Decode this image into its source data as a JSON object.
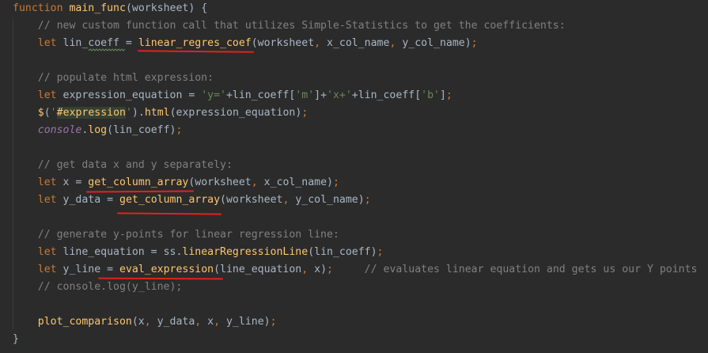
{
  "editor": {
    "lines": [
      {
        "tokens": [
          {
            "t": "function ",
            "c": "kw"
          },
          {
            "t": "main_func",
            "c": "fn"
          },
          {
            "t": "(worksheet) {",
            "c": "pl"
          }
        ]
      },
      {
        "tokens": [
          {
            "t": "    // new custom function call that utilizes Simple-Statistics to get the coefficients:",
            "c": "cm"
          }
        ]
      },
      {
        "tokens": [
          {
            "t": "    ",
            "c": "pl"
          },
          {
            "t": "let ",
            "c": "kw"
          },
          {
            "t": "lin_coeff = ",
            "c": "pl"
          },
          {
            "t": "linear_regres_coef",
            "c": "fn"
          },
          {
            "t": "(worksheet",
            "c": "pl"
          },
          {
            "t": ", ",
            "c": "kw"
          },
          {
            "t": "x_col_name",
            "c": "pl"
          },
          {
            "t": ", ",
            "c": "kw"
          },
          {
            "t": "y_col_name)",
            "c": "pl"
          },
          {
            "t": ";",
            "c": "kw"
          }
        ]
      },
      {
        "tokens": []
      },
      {
        "tokens": [
          {
            "t": "    // populate html expression:",
            "c": "cm"
          }
        ]
      },
      {
        "tokens": [
          {
            "t": "    ",
            "c": "pl"
          },
          {
            "t": "let ",
            "c": "kw"
          },
          {
            "t": "expression_equation = ",
            "c": "pl"
          },
          {
            "t": "'y='",
            "c": "str"
          },
          {
            "t": "+lin_coeff[",
            "c": "pl"
          },
          {
            "t": "'m'",
            "c": "str"
          },
          {
            "t": "]+",
            "c": "pl"
          },
          {
            "t": "'x+'",
            "c": "str"
          },
          {
            "t": "+lin_coeff[",
            "c": "pl"
          },
          {
            "t": "'b'",
            "c": "str"
          },
          {
            "t": "]",
            "c": "pl"
          },
          {
            "t": ";",
            "c": "kw"
          }
        ]
      },
      {
        "tokens": [
          {
            "t": "    ",
            "c": "pl"
          },
          {
            "t": "$",
            "c": "fn"
          },
          {
            "t": "(",
            "c": "pl"
          },
          {
            "t": "'",
            "c": "str"
          },
          {
            "t": "#expression",
            "c": "sel"
          },
          {
            "t": "'",
            "c": "str"
          },
          {
            "t": ").",
            "c": "pl"
          },
          {
            "t": "html",
            "c": "fn"
          },
          {
            "t": "(expression_equation)",
            "c": "pl"
          },
          {
            "t": ";",
            "c": "kw"
          }
        ]
      },
      {
        "tokens": [
          {
            "t": "    ",
            "c": "pl"
          },
          {
            "t": "console",
            "c": "it"
          },
          {
            "t": ".",
            "c": "pl"
          },
          {
            "t": "log",
            "c": "fn"
          },
          {
            "t": "(lin_coeff)",
            "c": "pl"
          },
          {
            "t": ";",
            "c": "kw"
          }
        ]
      },
      {
        "tokens": []
      },
      {
        "tokens": [
          {
            "t": "    // get data x and y separately:",
            "c": "cm"
          }
        ]
      },
      {
        "tokens": [
          {
            "t": "    ",
            "c": "pl"
          },
          {
            "t": "let ",
            "c": "kw"
          },
          {
            "t": "x = ",
            "c": "pl"
          },
          {
            "t": "get_column_array",
            "c": "fn"
          },
          {
            "t": "(worksheet",
            "c": "pl"
          },
          {
            "t": ", ",
            "c": "kw"
          },
          {
            "t": "x_col_name)",
            "c": "pl"
          },
          {
            "t": ";",
            "c": "kw"
          }
        ]
      },
      {
        "tokens": [
          {
            "t": "    ",
            "c": "pl"
          },
          {
            "t": "let ",
            "c": "kw"
          },
          {
            "t": "y_data = ",
            "c": "pl"
          },
          {
            "t": "get_column_array",
            "c": "fn"
          },
          {
            "t": "(worksheet",
            "c": "pl"
          },
          {
            "t": ", ",
            "c": "kw"
          },
          {
            "t": "y_col_name)",
            "c": "pl"
          },
          {
            "t": ";",
            "c": "kw"
          }
        ]
      },
      {
        "tokens": []
      },
      {
        "tokens": [
          {
            "t": "    // generate y-points for linear regression line:",
            "c": "cm"
          }
        ]
      },
      {
        "tokens": [
          {
            "t": "    ",
            "c": "pl"
          },
          {
            "t": "let ",
            "c": "kw"
          },
          {
            "t": "line_equation = ss.",
            "c": "pl"
          },
          {
            "t": "linearRegressionLine",
            "c": "fn"
          },
          {
            "t": "(lin_coeff)",
            "c": "pl"
          },
          {
            "t": ";",
            "c": "kw"
          }
        ]
      },
      {
        "tokens": [
          {
            "t": "    ",
            "c": "pl"
          },
          {
            "t": "let ",
            "c": "kw"
          },
          {
            "t": "y_line = ",
            "c": "pl"
          },
          {
            "t": "eval_expression",
            "c": "fn"
          },
          {
            "t": "(line_equation",
            "c": "pl"
          },
          {
            "t": ", ",
            "c": "kw"
          },
          {
            "t": "x)",
            "c": "pl"
          },
          {
            "t": ";",
            "c": "kw"
          },
          {
            "t": "     // evaluates linear equation and gets us our Y points",
            "c": "cm"
          }
        ]
      },
      {
        "tokens": [
          {
            "t": "    // console.log(y_line);",
            "c": "cm"
          }
        ]
      },
      {
        "tokens": []
      },
      {
        "tokens": [
          {
            "t": "    ",
            "c": "pl"
          },
          {
            "t": "plot_comparison",
            "c": "fn"
          },
          {
            "t": "(x",
            "c": "pl"
          },
          {
            "t": ", ",
            "c": "kw"
          },
          {
            "t": "y_data",
            "c": "pl"
          },
          {
            "t": ", ",
            "c": "kw"
          },
          {
            "t": "x",
            "c": "pl"
          },
          {
            "t": ", ",
            "c": "kw"
          },
          {
            "t": "y_line)",
            "c": "pl"
          },
          {
            "t": ";",
            "c": "kw"
          }
        ]
      },
      {
        "tokens": [
          {
            "t": "}",
            "c": "pl"
          }
        ]
      }
    ]
  },
  "colors": {
    "background": "#2b2b2b",
    "keyword": "#cc7832",
    "function": "#ffc66d",
    "comment": "#808080",
    "string": "#6a8759",
    "plain": "#a9b7c6",
    "console": "#9876aa",
    "annotation": "#e0231c"
  }
}
